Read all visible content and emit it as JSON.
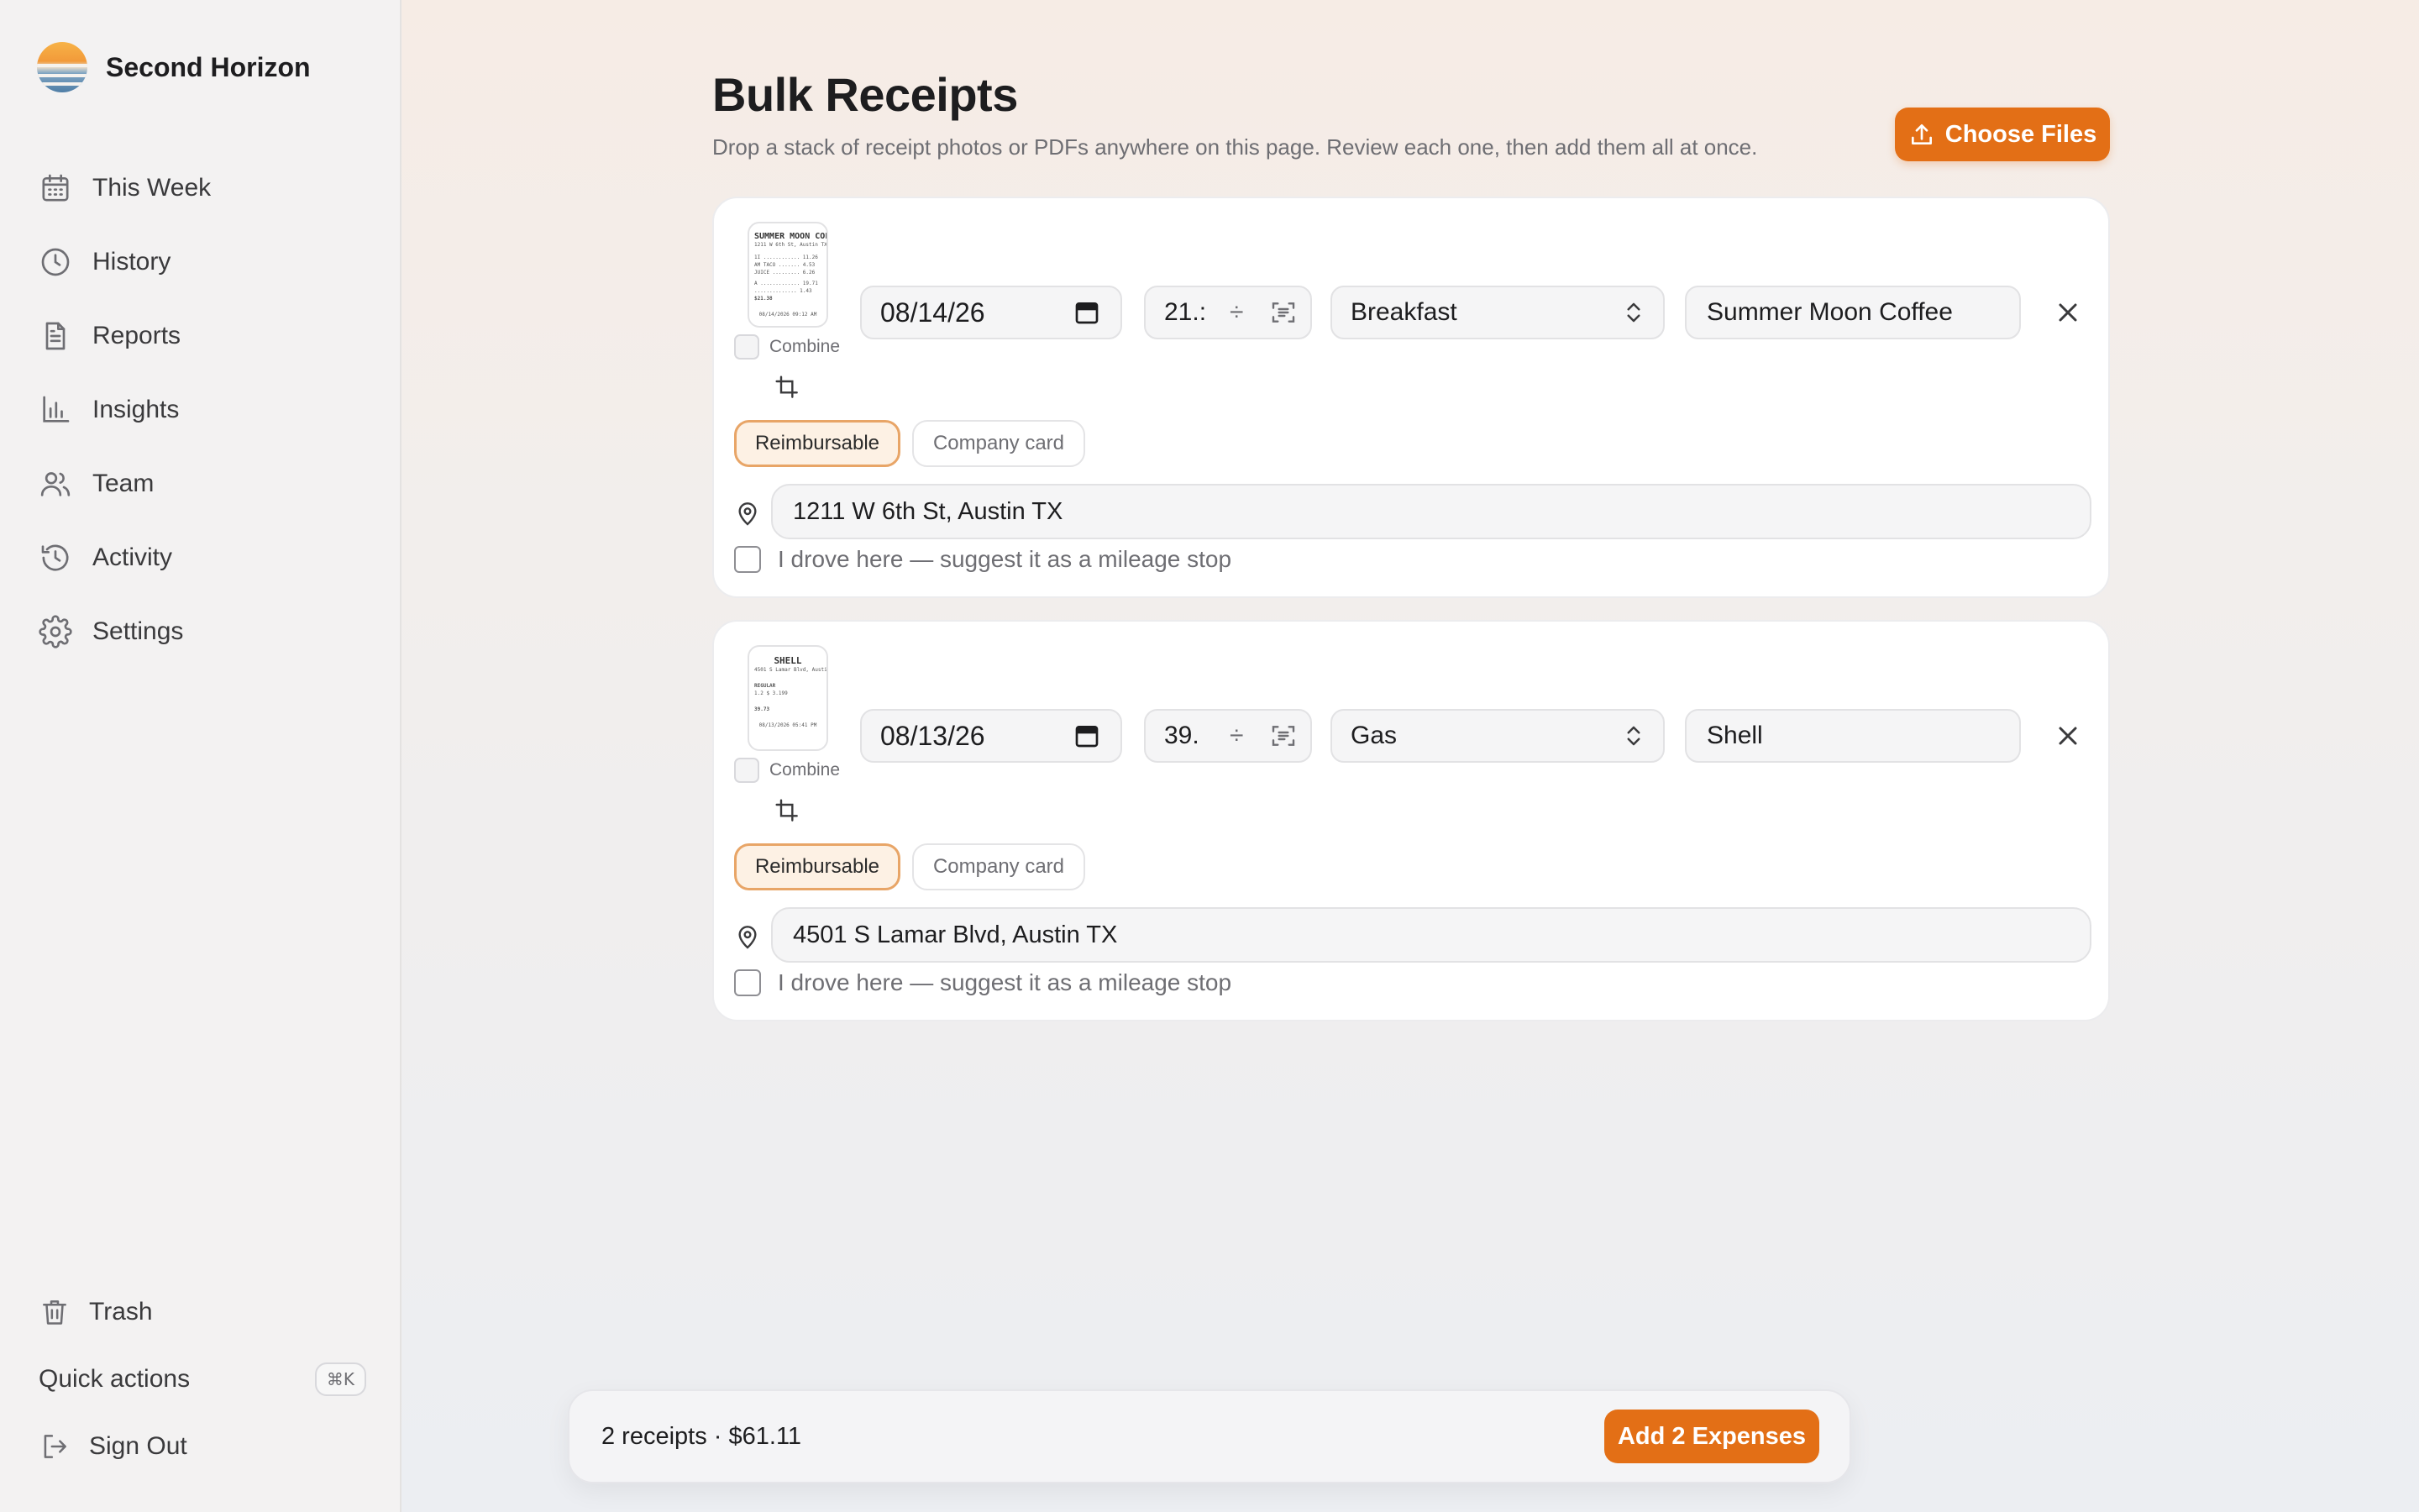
{
  "brand": {
    "name": "Second Horizon"
  },
  "nav": {
    "items": [
      {
        "label": "This Week",
        "icon": "calendar-icon"
      },
      {
        "label": "History",
        "icon": "clock-icon"
      },
      {
        "label": "Reports",
        "icon": "document-icon"
      },
      {
        "label": "Insights",
        "icon": "bar-chart-icon"
      },
      {
        "label": "Team",
        "icon": "users-icon"
      },
      {
        "label": "Activity",
        "icon": "history-icon"
      },
      {
        "label": "Settings",
        "icon": "gear-icon"
      }
    ],
    "bottom": {
      "trash": "Trash",
      "quick_actions": "Quick actions",
      "quick_actions_shortcut": "⌘K",
      "sign_out": "Sign Out"
    }
  },
  "header": {
    "title": "Bulk Receipts",
    "subtitle": "Drop a stack of receipt photos or PDFs anywhere on this page. Review each one, then add them all at once.",
    "choose_files": "Choose Files"
  },
  "receipts": [
    {
      "thumb_title": "SUMMER MOON COFFE",
      "date": "08/14/26",
      "amount": "21.:",
      "category": "Breakfast",
      "merchant": "Summer Moon Coffee",
      "combine_label": "Combine",
      "reimbursable_label": "Reimbursable",
      "company_card_label": "Company card",
      "address": "1211 W 6th St, Austin TX",
      "drove_label": "I drove here — suggest it as a mileage stop"
    },
    {
      "thumb_title": "SHELL",
      "date": "08/13/26",
      "amount": "39.",
      "category": "Gas",
      "merchant": "Shell",
      "combine_label": "Combine",
      "reimbursable_label": "Reimbursable",
      "company_card_label": "Company card",
      "address": "4501 S Lamar Blvd, Austin TX",
      "drove_label": "I drove here — suggest it as a mileage stop"
    }
  ],
  "footer": {
    "summary": "2 receipts · $61.11",
    "add_button": "Add 2 Expenses"
  },
  "colors": {
    "accent": "#e36f16",
    "reimbursable_bg": "#fdf1e4"
  }
}
